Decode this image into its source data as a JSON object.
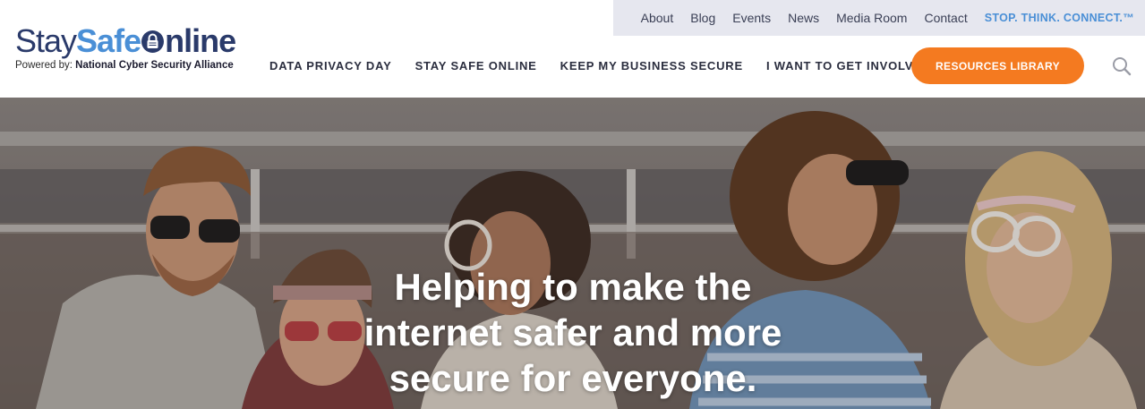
{
  "brand": {
    "logo_stay": "Stay",
    "logo_safe": "Safe",
    "logo_online_suffix": "nline",
    "powered_prefix": "Powered by:",
    "powered_org": "National Cyber Security Alliance"
  },
  "utility_nav": {
    "items": [
      "About",
      "Blog",
      "Events",
      "News",
      "Media Room",
      "Contact"
    ],
    "campaign": "STOP. THINK. CONNECT.™"
  },
  "main_nav": {
    "items": [
      "DATA PRIVACY DAY",
      "STAY SAFE ONLINE",
      "KEEP MY BUSINESS SECURE",
      "I WANT TO GET INVOLVED"
    ]
  },
  "cta": {
    "resources_label": "RESOURCES LIBRARY"
  },
  "icons": {
    "search": "search-icon",
    "lock": "lock-icon"
  },
  "hero": {
    "line1": "Helping to make the",
    "line2": "internet safer and more",
    "line3": "secure for everyone."
  },
  "colors": {
    "brand_navy": "#2a3a6a",
    "brand_blue": "#4a8fd6",
    "accent_orange": "#f47a20",
    "utility_bg": "#e6e7ef"
  }
}
